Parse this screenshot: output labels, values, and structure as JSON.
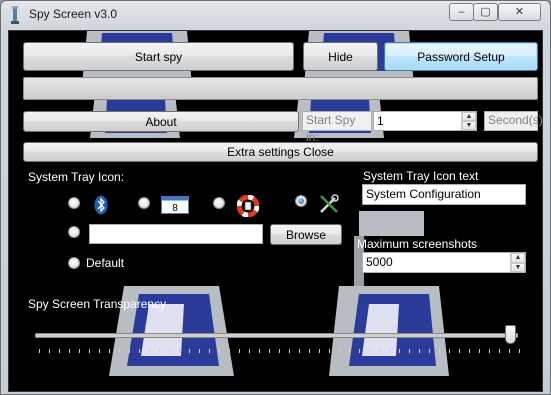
{
  "window": {
    "title": "Spy Screen v3.0",
    "controls": {
      "minimize": "–",
      "maximize": "▢",
      "close": "✕"
    }
  },
  "buttons": {
    "start_spy": "Start spy",
    "hide": "Hide",
    "password_setup": "Password Setup",
    "about": "About",
    "extra_settings_close": "Extra settings Close",
    "browse": "Browse"
  },
  "schedule": {
    "start_spy_in_label": "Start Spy in:",
    "start_spy_in_value": "1",
    "seconds_label": "Second(s)"
  },
  "tray_icon": {
    "label": "System Tray Icon:",
    "options": [
      "bluetooth-icon",
      "calendar-icon",
      "lifebuoy-icon",
      "tools-icon",
      "custom-path",
      "Default"
    ],
    "selected": "tools-icon",
    "custom_path_value": "",
    "default_label": "Default",
    "text_label": "System Tray Icon text",
    "text_value": "System Configuration"
  },
  "screenshots": {
    "max_label": "Maximum screenshots",
    "max_value": "5000"
  },
  "transparency": {
    "label": "Spy Screen Transparency",
    "value_fraction": 1.0
  },
  "colors": {
    "client_background": "#000000",
    "accent_blue": "#1b5f9a"
  }
}
